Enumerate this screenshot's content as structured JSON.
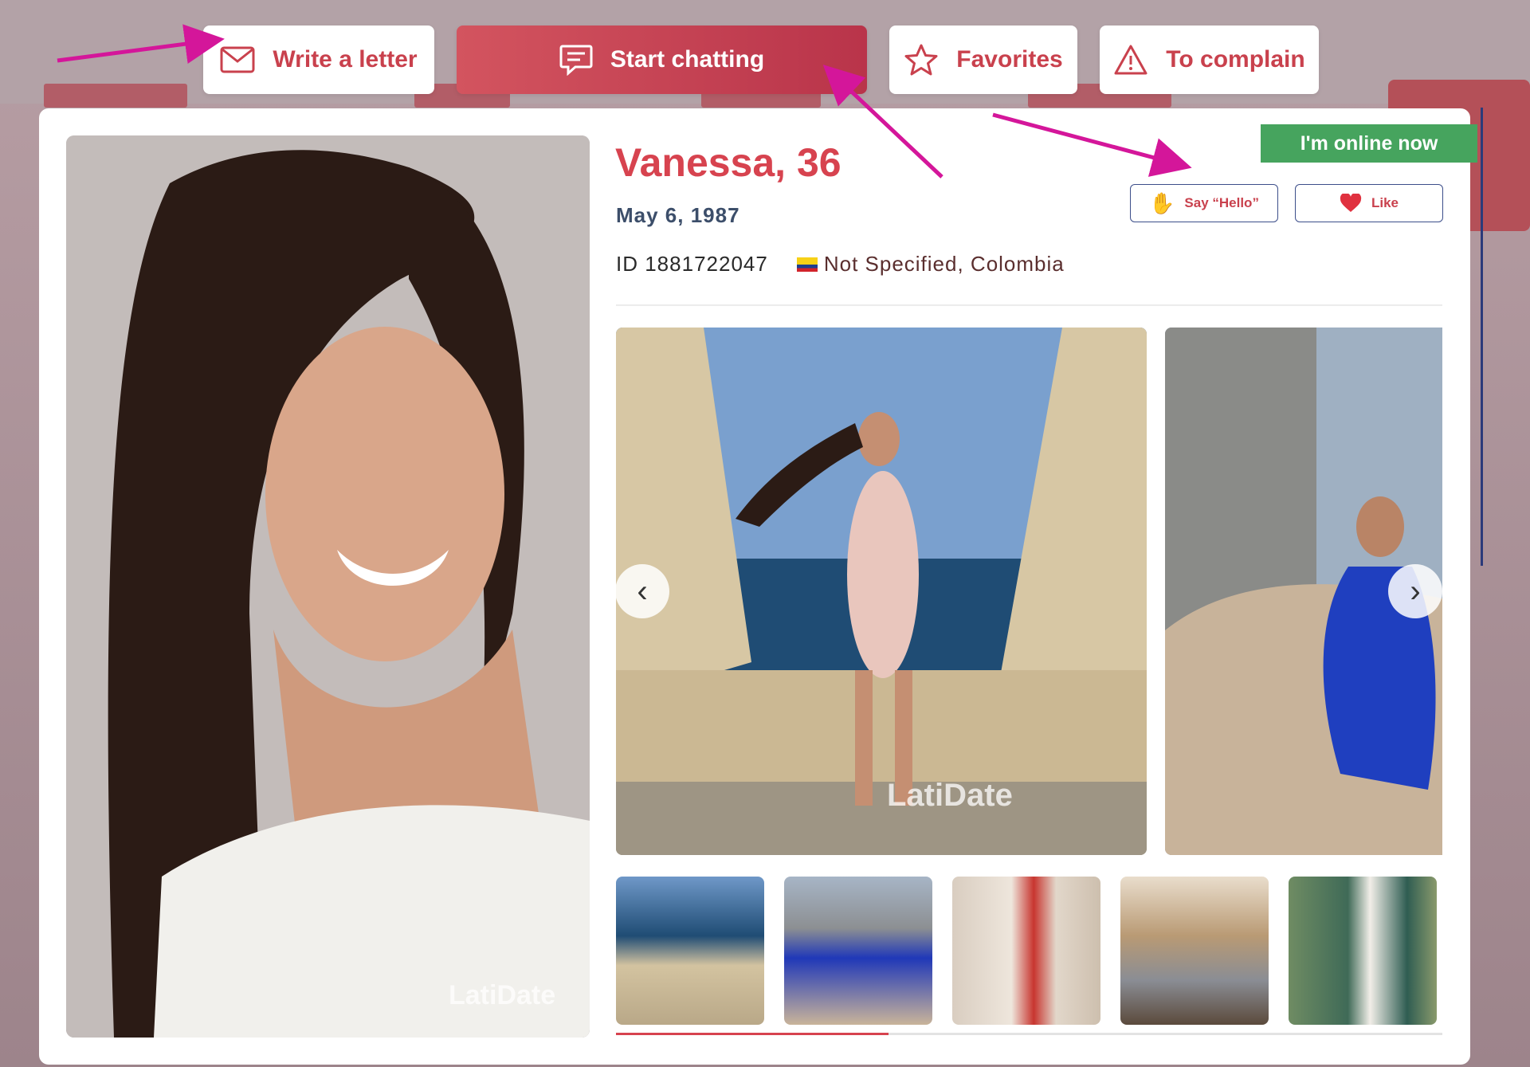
{
  "actions": {
    "write_letter": "Write a letter",
    "start_chatting": "Start chatting",
    "favorites": "Favorites",
    "complain": "To complain"
  },
  "profile": {
    "name_age": "Vanessa, 36",
    "birth_date": "May 6, 1987",
    "id_text": "ID 1881722047",
    "location": "Not Specified, Colombia",
    "online_status": "I'm online now"
  },
  "quick_actions": {
    "say_hello": "Say “Hello”",
    "like": "Like"
  },
  "gallery": {
    "watermark": "LatiDate",
    "thumbnail_count": 5,
    "progress_fraction": 0.33
  },
  "colors": {
    "brand_red": "#d7434f",
    "online_green": "#46a45e",
    "annotation_magenta": "#d4169a"
  }
}
